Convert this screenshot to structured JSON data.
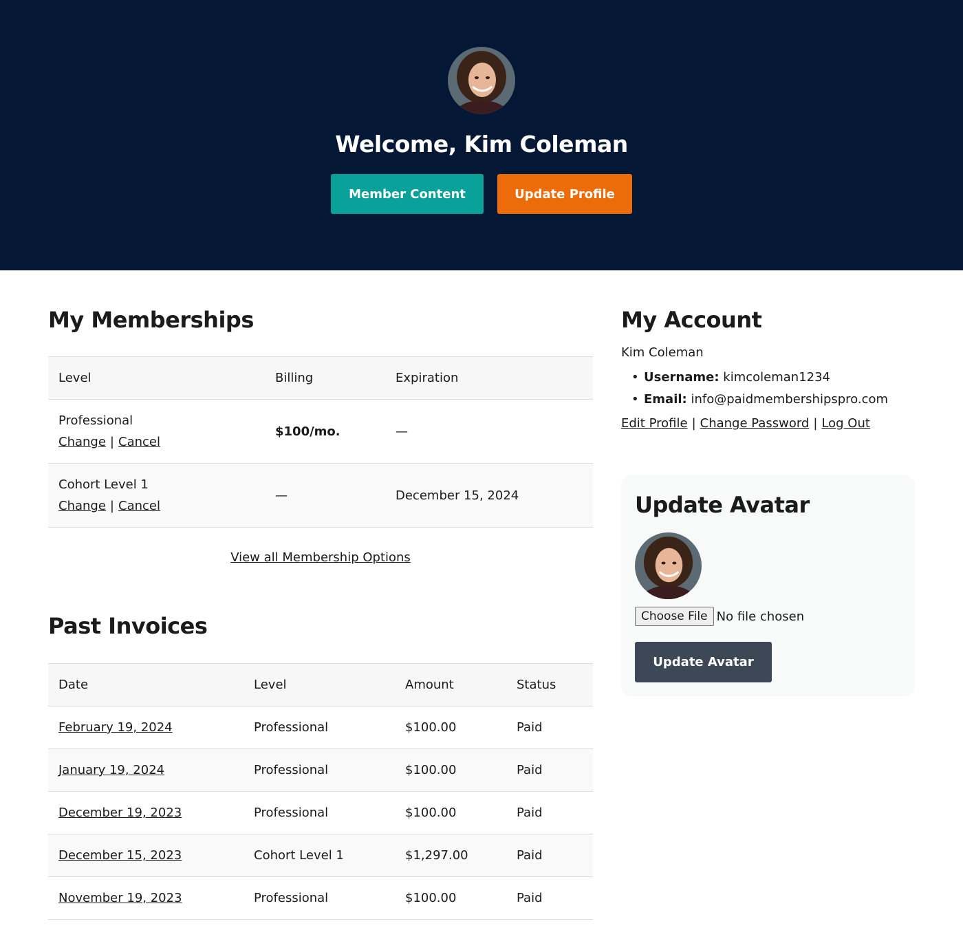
{
  "hero": {
    "title": "Welcome, Kim Coleman",
    "buttons": {
      "member_content": "Member Content",
      "update_profile": "Update Profile"
    }
  },
  "memberships": {
    "heading": "My Memberships",
    "columns": [
      "Level",
      "Billing",
      "Expiration"
    ],
    "rows": [
      {
        "level": "Professional",
        "billing": "$100/mo.",
        "expiration": "—",
        "change": "Change",
        "sep": "|",
        "cancel": "Cancel"
      },
      {
        "level": "Cohort Level 1",
        "billing": "—",
        "expiration": "December 15, 2024",
        "change": "Change",
        "sep": "|",
        "cancel": "Cancel"
      }
    ],
    "view_all": "View all Membership Options"
  },
  "invoices": {
    "heading": "Past Invoices",
    "columns": [
      "Date",
      "Level",
      "Amount",
      "Status"
    ],
    "rows": [
      {
        "date": "February 19, 2024",
        "level": "Professional",
        "amount": "$100.00",
        "status": "Paid"
      },
      {
        "date": "January 19, 2024",
        "level": "Professional",
        "amount": "$100.00",
        "status": "Paid"
      },
      {
        "date": "December 19, 2023",
        "level": "Professional",
        "amount": "$100.00",
        "status": "Paid"
      },
      {
        "date": "December 15, 2023",
        "level": "Cohort Level 1",
        "amount": "$1,297.00",
        "status": "Paid"
      },
      {
        "date": "November 19, 2023",
        "level": "Professional",
        "amount": "$100.00",
        "status": "Paid"
      }
    ]
  },
  "account": {
    "heading": "My Account",
    "name": "Kim Coleman",
    "username_label": "Username:",
    "username": "kimcoleman1234",
    "email_label": "Email:",
    "email": "info@paidmembershipspro.com",
    "links": {
      "edit_profile": "Edit Profile",
      "change_password": "Change Password",
      "log_out": "Log Out",
      "sep": "|"
    }
  },
  "avatar_card": {
    "heading": "Update Avatar",
    "choose_file": "Choose File",
    "file_status": "No file chosen",
    "submit": "Update Avatar"
  },
  "colors": {
    "hero_bg": "#041735",
    "teal": "#0aa19a",
    "orange": "#ec6c09",
    "slate": "#3c4855"
  }
}
